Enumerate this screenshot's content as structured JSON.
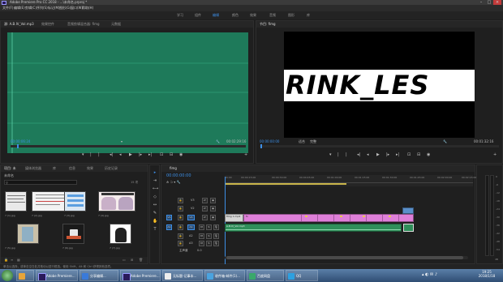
{
  "window": {
    "title": "Adobe Premiere Pro CC 2018 - ...\\未命名.prproj *"
  },
  "menu": [
    "文件(F)",
    "编辑(E)",
    "剪辑(C)",
    "序列(S)",
    "标记(M)",
    "图形(G)",
    "窗口(W)",
    "帮助(H)"
  ],
  "workspaces": {
    "tabs": [
      "学习",
      "组件",
      "编辑",
      "颜色",
      "效果",
      "音频",
      "图形",
      "库"
    ],
    "active_index": 2
  },
  "top_button": "空间 ▸",
  "source_panel": {
    "tabs": [
      "源: A.B.IV_Vol.mp3",
      "效果控件",
      "音频剪辑混合器: fimg",
      "元数据"
    ],
    "tc_left": "00:00:06:24",
    "tc_right": "00:02:29:16",
    "fit_label": "▾",
    "waveform_color": "#1e7a5a"
  },
  "program_panel": {
    "tabs": [
      "节目: fimg"
    ],
    "tc_left": "00:00:00:00",
    "fit_label": "适合",
    "fraction_label": "完整",
    "tc_right": "00:01:32:16",
    "title_text": "RINK_LES"
  },
  "project_panel": {
    "tabs": [
      "项目: 未",
      "媒体浏览器",
      "库",
      "信息",
      "效果",
      "历史记录"
    ],
    "project_name": "未命名",
    "search_placeholder": "",
    "item_count": "15 项",
    "items": [
      {
        "label": "7 (1).jpg",
        "dur": "5:00"
      },
      {
        "label": "7 (2).jpg",
        "dur": "5:00"
      },
      {
        "label": "7 (3).jpg",
        "dur": "5:00"
      },
      {
        "label": "7 (4).jpg",
        "dur": "5:00"
      },
      {
        "label": "7 (5).jpg",
        "dur": "5:00"
      },
      {
        "label": "7 (6).jpg",
        "dur": "5:00"
      },
      {
        "label": "7 (7).jpg",
        "dur": "5:00"
      }
    ]
  },
  "timeline": {
    "tab": "fimg",
    "timecode": "00:00:00:00",
    "ruler": [
      "00:00",
      "00:00:15:00",
      "00:00:30:00",
      "00:00:45:00",
      "00:01:00:00",
      "00:01:15:00",
      "00:01:30:00",
      "00:01:45:00",
      "00:02:00:00",
      "00:02:15:00"
    ],
    "video_tracks": [
      "V3",
      "V2",
      "V1"
    ],
    "audio_tracks": [
      "A1",
      "A2",
      "A3"
    ],
    "master_label": "主声道",
    "master_value": "0.0",
    "clips": [
      {
        "label": "fimg 1.mp4",
        "track": "V1"
      },
      {
        "label": "fx",
        "track": "V1"
      },
      {
        "label": "A.B.IV_Vol.mp3",
        "track": "A1"
      }
    ]
  },
  "meter": {
    "ticks": [
      "0",
      "-6",
      "-12",
      "-18",
      "-24",
      "-30",
      "-36",
      "-42",
      "-48",
      "-54"
    ],
    "unit": "dB"
  },
  "status": "单击以选择，或单击空白处并拖动以进行框选。使用 Shift、Alt 和 Ctrl 获得其他选项。",
  "taskbar": {
    "items": [
      "Adobe Premiere...",
      "Adobe Premiere...",
      "Adobe Premiere...",
      "分享编辑...",
      "无标题-记事本...",
      "收件箱-邮件(1)...",
      "百度网盘",
      "QQ"
    ],
    "clock_time": "19:25",
    "clock_date": "2018/1/18"
  }
}
